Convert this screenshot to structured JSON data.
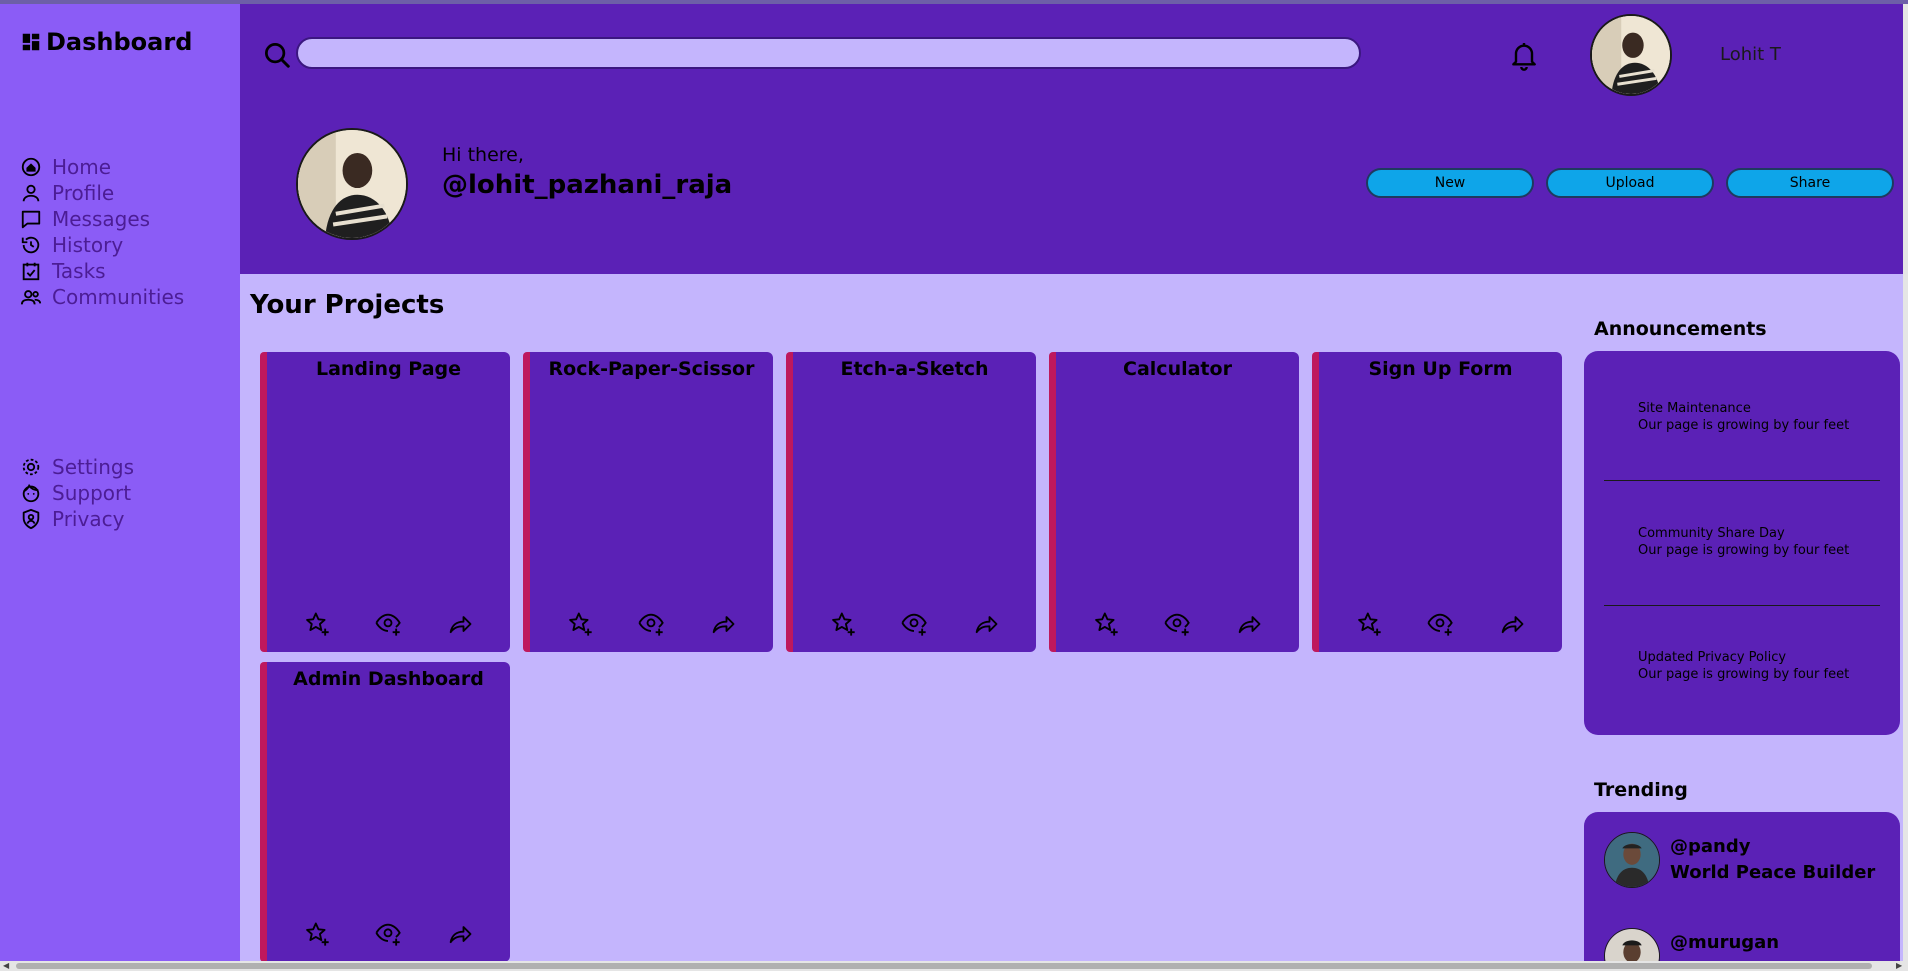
{
  "colors": {
    "sidebar": "#8b5cf6",
    "header": "#5b21b6",
    "content": "#c4b5fd",
    "card_accent": "#be185d",
    "button": "#0ea5e9"
  },
  "sidebar": {
    "brand": "Dashboard",
    "main_items": [
      {
        "label": "Home",
        "icon": "home-icon"
      },
      {
        "label": "Profile",
        "icon": "profile-icon"
      },
      {
        "label": "Messages",
        "icon": "messages-icon"
      },
      {
        "label": "History",
        "icon": "history-icon"
      },
      {
        "label": "Tasks",
        "icon": "tasks-icon"
      },
      {
        "label": "Communities",
        "icon": "communities-icon"
      }
    ],
    "bottom_items": [
      {
        "label": "Settings",
        "icon": "settings-icon"
      },
      {
        "label": "Support",
        "icon": "support-icon"
      },
      {
        "label": "Privacy",
        "icon": "privacy-icon"
      }
    ]
  },
  "header": {
    "search_value": "",
    "user_name": "Lohit T",
    "greeting": "Hi there,",
    "handle": "@lohit_pazhani_raja",
    "buttons": [
      "New",
      "Upload",
      "Share"
    ]
  },
  "projects": {
    "title": "Your Projects",
    "items": [
      "Landing Page",
      "Rock-Paper-Scissor",
      "Etch-a-Sketch",
      "Calculator",
      "Sign Up Form",
      "Admin Dashboard"
    ]
  },
  "announcements": {
    "title": "Announcements",
    "items": [
      {
        "title": "Site Maintenance",
        "body": "Our page is growing by four feet"
      },
      {
        "title": "Community Share Day",
        "body": "Our page is growing by four feet"
      },
      {
        "title": "Updated Privacy Policy",
        "body": "Our page is growing by four feet"
      }
    ]
  },
  "trending": {
    "title": "Trending",
    "items": [
      {
        "handle": "@pandy",
        "project": "World Peace Builder"
      },
      {
        "handle": "@murugan",
        "project": ""
      }
    ]
  }
}
